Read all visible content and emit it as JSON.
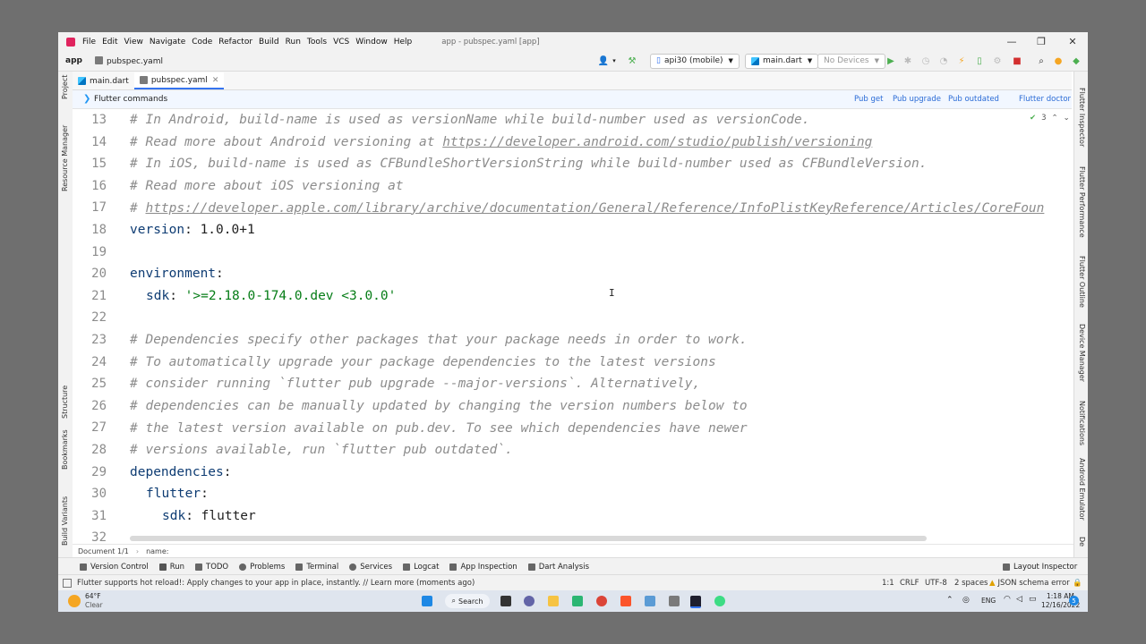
{
  "titlebar": {
    "menu": [
      "File",
      "Edit",
      "View",
      "Navigate",
      "Code",
      "Refactor",
      "Build",
      "Run",
      "Tools",
      "VCS",
      "Window",
      "Help"
    ],
    "window_title": "app - pubspec.yaml [app]",
    "minimize": "—",
    "maximize": "❐",
    "close": "✕"
  },
  "navbar": {
    "project": "app",
    "file": "pubspec.yaml",
    "device_config": "api30 (mobile)",
    "run_config": "main.dart",
    "devices": "No Devices"
  },
  "tabs": [
    {
      "label": "main.dart",
      "active": false
    },
    {
      "label": "pubspec.yaml",
      "active": true
    }
  ],
  "flutter_commands": {
    "label": "Flutter commands",
    "actions": [
      "Pub get",
      "Pub upgrade",
      "Pub outdated",
      "Flutter doctor"
    ]
  },
  "inspection": {
    "count": "3",
    "up": "⌃",
    "down": "⌄"
  },
  "editor": {
    "lines": [
      {
        "n": "13",
        "indent": 0,
        "parts": [
          {
            "t": "# In Android, build-name is used as versionName while build-number used as versionCode.",
            "c": "cmt"
          }
        ]
      },
      {
        "n": "14",
        "indent": 0,
        "parts": [
          {
            "t": "# Read more about Android versioning at ",
            "c": "cmt"
          },
          {
            "t": "https://developer.android.com/studio/publish/versioning",
            "c": "lnk"
          }
        ]
      },
      {
        "n": "15",
        "indent": 0,
        "parts": [
          {
            "t": "# In iOS, build-name is used as CFBundleShortVersionString while build-number used as CFBundleVersion.",
            "c": "cmt"
          }
        ]
      },
      {
        "n": "16",
        "indent": 0,
        "parts": [
          {
            "t": "# Read more about iOS versioning at",
            "c": "cmt"
          }
        ]
      },
      {
        "n": "17",
        "indent": 0,
        "parts": [
          {
            "t": "# ",
            "c": "cmt"
          },
          {
            "t": "https://developer.apple.com/library/archive/documentation/General/Reference/InfoPlistKeyReference/Articles/CoreFoun",
            "c": "lnk"
          }
        ]
      },
      {
        "n": "18",
        "indent": 0,
        "parts": [
          {
            "t": "version",
            "c": "key"
          },
          {
            "t": ": 1.0.0+1",
            "c": "val"
          }
        ]
      },
      {
        "n": "19",
        "indent": 0,
        "parts": []
      },
      {
        "n": "20",
        "indent": 0,
        "parts": [
          {
            "t": "environment",
            "c": "key"
          },
          {
            "t": ":",
            "c": "val"
          }
        ]
      },
      {
        "n": "21",
        "indent": 1,
        "parts": [
          {
            "t": "sdk",
            "c": "key"
          },
          {
            "t": ": ",
            "c": "val"
          },
          {
            "t": "'>=2.18.0-174.0.dev <3.0.0'",
            "c": "str"
          }
        ]
      },
      {
        "n": "22",
        "indent": 0,
        "parts": []
      },
      {
        "n": "23",
        "indent": 0,
        "parts": [
          {
            "t": "# Dependencies specify other packages that your package needs in order to work.",
            "c": "cmt"
          }
        ]
      },
      {
        "n": "24",
        "indent": 0,
        "parts": [
          {
            "t": "# To automatically upgrade your package dependencies to the latest versions",
            "c": "cmt"
          }
        ]
      },
      {
        "n": "25",
        "indent": 0,
        "parts": [
          {
            "t": "# consider running `flutter pub upgrade --major-versions`. Alternatively,",
            "c": "cmt"
          }
        ]
      },
      {
        "n": "26",
        "indent": 0,
        "parts": [
          {
            "t": "# dependencies can be manually updated by changing the version numbers below to",
            "c": "cmt"
          }
        ]
      },
      {
        "n": "27",
        "indent": 0,
        "parts": [
          {
            "t": "# the latest version available on pub.dev. To see which dependencies have newer",
            "c": "cmt"
          }
        ]
      },
      {
        "n": "28",
        "indent": 0,
        "parts": [
          {
            "t": "# versions available, run `flutter pub outdated`.",
            "c": "cmt"
          }
        ]
      },
      {
        "n": "29",
        "indent": 0,
        "parts": [
          {
            "t": "dependencies",
            "c": "key"
          },
          {
            "t": ":",
            "c": "val"
          }
        ]
      },
      {
        "n": "30",
        "indent": 1,
        "parts": [
          {
            "t": "flutter",
            "c": "key"
          },
          {
            "t": ":",
            "c": "val"
          }
        ]
      },
      {
        "n": "31",
        "indent": 2,
        "parts": [
          {
            "t": "sdk",
            "c": "key"
          },
          {
            "t": ": flutter",
            "c": "val"
          }
        ]
      },
      {
        "n": "32",
        "indent": 0,
        "parts": []
      }
    ]
  },
  "left_tools": [
    "Project",
    "Resource Manager",
    "Structure",
    "Bookmarks",
    "Build Variants"
  ],
  "right_tools": [
    "Flutter Inspector",
    "Flutter Performance",
    "Flutter Outline",
    "Device Manager",
    "Notifications",
    "Android Emulator",
    "De"
  ],
  "breadcrumb": {
    "doc": "Document 1/1",
    "path": "name:"
  },
  "toolwindows": [
    "Version Control",
    "Run",
    "TODO",
    "Problems",
    "Terminal",
    "Services",
    "Logcat",
    "App Inspection",
    "Dart Analysis"
  ],
  "layout_inspector": "Layout Inspector",
  "status": {
    "message": "Flutter supports hot reload!: Apply changes to your app in place, instantly. // Learn more (moments ago)",
    "position": "1:1",
    "line_sep": "CRLF",
    "encoding": "UTF-8",
    "indent": "2 spaces",
    "schema": "JSON schema error"
  },
  "taskbar": {
    "temp": "64°F",
    "weather": "Clear",
    "search": "Search",
    "lang": "ENG",
    "time": "1:18 AM",
    "date": "12/16/2022",
    "notif_count": "5"
  },
  "colors": {
    "accent": "#3574f0",
    "comment": "#8c8c8c",
    "key": "#0e3c73",
    "string": "#067d17"
  }
}
